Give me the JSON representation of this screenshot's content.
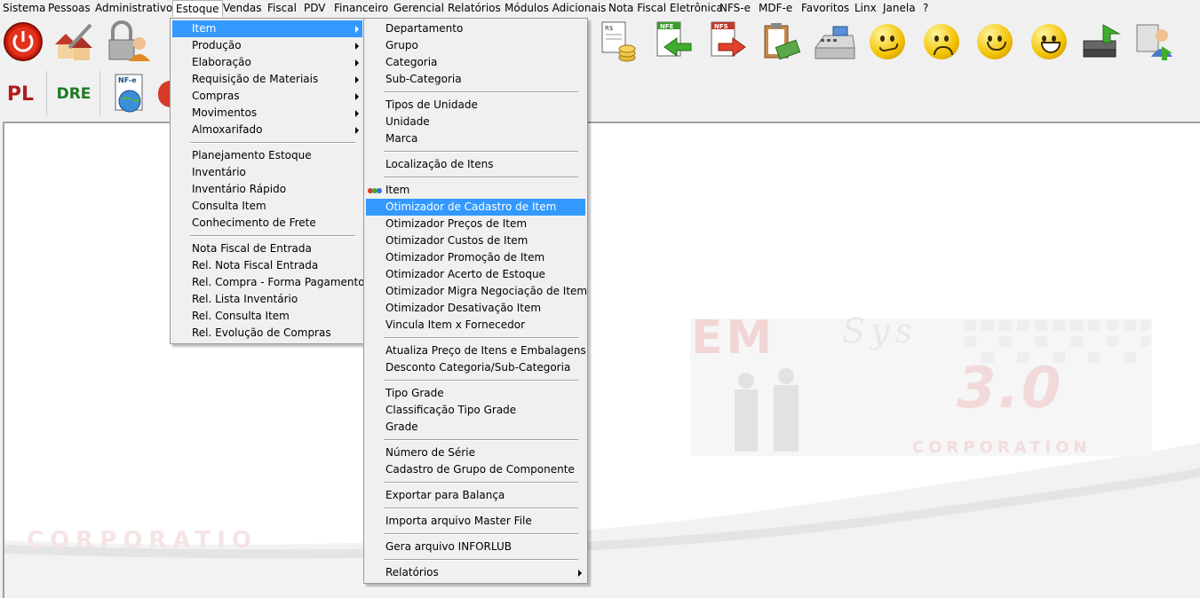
{
  "menubar": [
    "Sistema",
    "Pessoas",
    "Administrativo",
    "Estoque",
    "Vendas",
    "Fiscal",
    "PDV",
    "Financeiro",
    "Gerencial",
    "Relatórios",
    "Módulos Adicionais",
    "Nota Fiscal Eletrônica",
    "NFS-e",
    "MDF-e",
    "Favoritos",
    "Linx",
    "Janela",
    "?"
  ],
  "toolbar": {
    "pl_label": "PL",
    "dre_label": "DRE",
    "nfe_badge": "NF-e",
    "rs_badge": "R$",
    "nfe_in_badge": "NFE",
    "nfs_badge": "NFS"
  },
  "estoque_menu": {
    "group1": [
      "Item",
      "Produção",
      "Elaboração",
      "Requisição de Materiais",
      "Compras",
      "Movimentos",
      "Almoxarifado"
    ],
    "group2": [
      "Planejamento Estoque",
      "Inventário",
      "Inventário Rápido",
      "Consulta Item",
      "Conhecimento de Frete"
    ],
    "group3": [
      "Nota Fiscal de Entrada",
      "Rel. Nota Fiscal Entrada",
      "Rel. Compra - Forma Pagamento",
      "Rel. Lista Inventário",
      "Rel. Consulta Item",
      "Rel. Evolução de Compras"
    ]
  },
  "item_menu": {
    "group1": [
      "Departamento",
      "Grupo",
      "Categoria",
      "Sub-Categoria"
    ],
    "group2": [
      "Tipos de Unidade",
      "Unidade",
      "Marca"
    ],
    "group3": [
      "Localização de Itens"
    ],
    "group4": [
      "Item",
      "Otimizador de Cadastro de Item",
      "Otimizador Preços de Item",
      "Otimizador Custos de Item",
      "Otimizador Promoção de Item",
      "Otimizador Acerto de Estoque",
      "Otimizador Migra Negociação de Item",
      "Otimizador Desativação Item",
      "Vincula Item x Fornecedor"
    ],
    "group5": [
      "Atualiza Preço de Itens e Embalagens",
      "Desconto Categoria/Sub-Categoria"
    ],
    "group6": [
      "Tipo Grade",
      "Classificação Tipo Grade",
      "Grade"
    ],
    "group7": [
      "Número de Série",
      "Cadastro de Grupo de Componente"
    ],
    "group8": [
      "Exportar para Balança"
    ],
    "group9": [
      "Importa arquivo Master File"
    ],
    "group10": [
      "Gera arquivo INFORLUB"
    ],
    "group11": [
      "Relatórios"
    ]
  },
  "watermark": {
    "em": "EM",
    "sys": "Sys",
    "version": "3.0",
    "corp": "CORPORATION",
    "corp_left": "CORPORATIO"
  },
  "colors": {
    "highlight": "#3399ff",
    "watermark": "#e9c9c9"
  }
}
